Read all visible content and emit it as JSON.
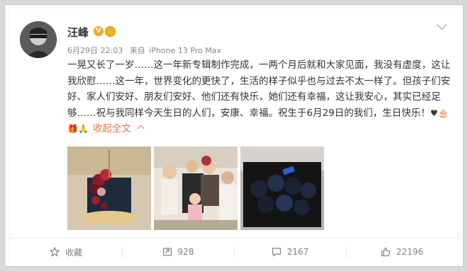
{
  "post": {
    "author": "汪峰",
    "date": "6月29日 22:03",
    "source_prefix": "来自",
    "source_device": "iPhone 13 Pro Max",
    "text_main": "一晃又长了一岁……这一年新专辑制作完成，一两个月后就和大家见面，我没有虚度，这让我欣慰……这一年，世界变化的更快了，生活的样子似乎也与过去不太一样了。但孩子们安好、家人们安好、朋友们安好、他们还有快乐，她们还有幸福，这让我安心，其实已经足够……祝与我同样今天生日的人们，安康、幸福。祝生于6月29日的我们，生日快乐！",
    "text_emoji": "♥🎂🎁🙏",
    "collapse_label": "收起全文",
    "collapse_icon": "chevron-up-icon",
    "verified_icon": "verified-v-icon",
    "medal_icon": "medal-icon"
  },
  "actions": {
    "favorite_label": "收藏",
    "repost_count": "928",
    "comment_count": "2167",
    "like_count": "22196"
  },
  "icons": {
    "favorite": "star-icon",
    "repost": "repost-icon",
    "comment": "comment-icon",
    "like": "thumbs-up-icon",
    "more": "chevron-down-icon"
  },
  "colors": {
    "accent": "#eb7350",
    "verified": "#f6a623",
    "muted": "#808080"
  }
}
